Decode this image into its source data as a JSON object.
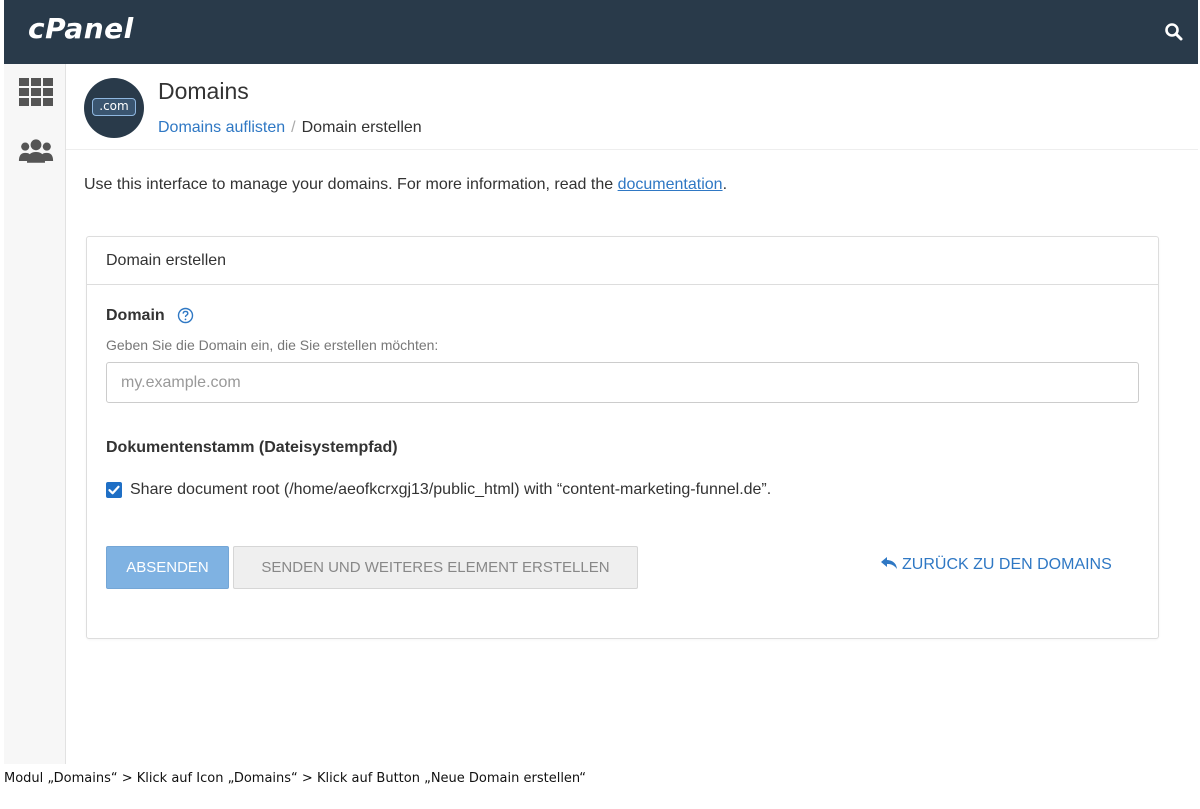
{
  "header": {
    "logo": "cPanel",
    "search_icon": "search-icon"
  },
  "sidebar": {
    "items": [
      {
        "icon": "grid-icon"
      },
      {
        "icon": "users-icon"
      }
    ]
  },
  "page": {
    "badge_text": ".com",
    "title": "Domains",
    "breadcrumb": {
      "parent": "Domains auflisten",
      "separator": "/",
      "current": "Domain erstellen"
    },
    "intro_text": "Use this interface to manage your domains. For more information, read the ",
    "intro_link": "documentation",
    "intro_end": "."
  },
  "panel": {
    "heading": "Domain erstellen",
    "domain_label": "Domain",
    "domain_hint": "Geben Sie die Domain ein, die Sie erstellen möchten:",
    "domain_placeholder": "my.example.com",
    "domain_value": "",
    "docroot_label": "Dokumentenstamm (Dateisystempfad)",
    "share_checked": true,
    "share_label": "Share document root (/home/aeofkcrxgj13/public_html) with “content-marketing-funnel.de”.",
    "submit_label": "ABSENDEN",
    "submit_more_label": "SENDEN UND WEITERES ELEMENT ERSTELLEN",
    "back_label": "ZURÜCK ZU DEN DOMAINS"
  },
  "caption": "Modul „Domains“ > Klick auf Icon „Domains“ > Klick auf Button „Neue Domain erstellen“",
  "colors": {
    "topbar": "#293a4a",
    "link": "#2f78c4",
    "submit": "#7fb2e2",
    "checkbox": "#1f6fc5"
  }
}
